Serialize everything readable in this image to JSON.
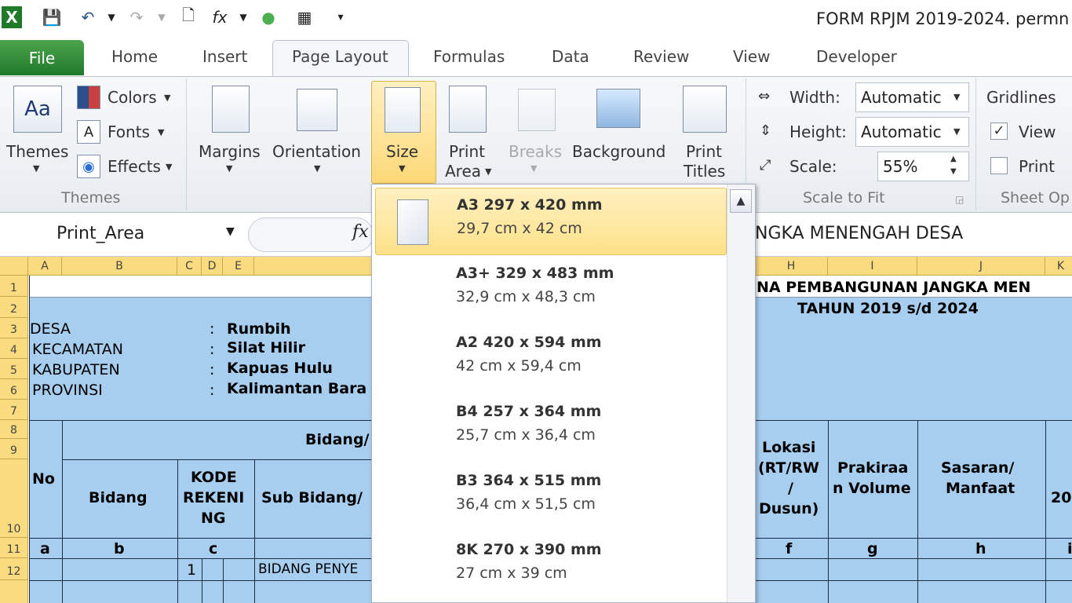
{
  "window": {
    "title": "FORM RPJM 2019-2024. permn"
  },
  "tabs": [
    "File",
    "Home",
    "Insert",
    "Page Layout",
    "Formulas",
    "Data",
    "Review",
    "View",
    "Developer"
  ],
  "ribbon": {
    "themes": {
      "label": "Themes",
      "colors": "Colors",
      "fonts": "Fonts",
      "effects": "Effects",
      "group": "Themes"
    },
    "page_setup": {
      "margins": "Margins",
      "orientation": "Orientation",
      "size": "Size",
      "print_area_1": "Print",
      "print_area_2": "Area",
      "breaks": "Breaks",
      "background": "Background",
      "print_titles_1": "Print",
      "print_titles_2": "Titles"
    },
    "scale": {
      "width_label": "Width:",
      "width_value": "Automatic",
      "height_label": "Height:",
      "height_value": "Automatic",
      "scale_label": "Scale:",
      "scale_value": "55%",
      "group": "Scale to Fit"
    },
    "sheet_options": {
      "gridlines": "Gridlines",
      "view": "View",
      "print": "Print",
      "group": "Sheet Op"
    }
  },
  "formula_bar": {
    "name_box": "Print_Area",
    "fx": "fx",
    "formula": "NGKA MENENGAH DESA"
  },
  "columns": [
    "A",
    "B",
    "C",
    "D",
    "E",
    "H",
    "I",
    "J",
    "K"
  ],
  "rows": [
    "1",
    "2",
    "3",
    "4",
    "5",
    "6",
    "7",
    "8",
    "9",
    "10",
    "11",
    "12"
  ],
  "sheet": {
    "title1": "NA PEMBANGUNAN JANGKA MEN",
    "title2": "TAHUN 2019 s/d 2024",
    "desa_label": "DESA",
    "kec_label": "KECAMATAN",
    "kab_label": "KABUPATEN",
    "prov_label": "PROVINSI",
    "colon": ":",
    "desa": "Rumbih",
    "kec": "Silat Hilir",
    "kab": "Kapuas Hulu",
    "prov": "Kalimantan Bara",
    "h_bidang_top": "Bidang/",
    "h_no": "No",
    "h_bidang": "Bidang",
    "h_kode1": "KODE",
    "h_kode2": "REKENI",
    "h_kode3": "NG",
    "h_subbidang": "Sub Bidang/",
    "h_lokasi1": "Lokasi",
    "h_lokasi2": "(RT/RW",
    "h_lokasi3": "/",
    "h_lokasi4": "Dusun)",
    "h_prakiraan1": "Prakiraa",
    "h_prakiraan2": "n Volume",
    "h_sasaran1": "Sasaran/",
    "h_sasaran2": "Manfaat",
    "h_20": "20",
    "l_a": "a",
    "l_b": "b",
    "l_c": "c",
    "l_f": "f",
    "l_g": "g",
    "l_h": "h",
    "l_i": "i",
    "r12_num": "1",
    "r12_text": "BIDANG PENYE"
  },
  "size_menu": [
    {
      "name": "A3 297 x 420 mm",
      "sub": "29,7 cm x 42 cm",
      "selected": true
    },
    {
      "name": "A3+ 329 x 483 mm",
      "sub": "32,9 cm x 48,3 cm"
    },
    {
      "name": "A2 420 x 594 mm",
      "sub": "42 cm x 59,4 cm"
    },
    {
      "name": "B4 257 x 364 mm",
      "sub": "25,7 cm x 36,4 cm"
    },
    {
      "name": "B3 364 x 515 mm",
      "sub": "36,4 cm x 51,5 cm"
    },
    {
      "name": "8K 270 x 390 mm",
      "sub": "27 cm x 39 cm"
    }
  ],
  "colors": {
    "accent_green": "#1f7a2a",
    "cell_blue": "#a7cdef",
    "header_orange": "#fadb80",
    "highlight": "#fde189"
  }
}
